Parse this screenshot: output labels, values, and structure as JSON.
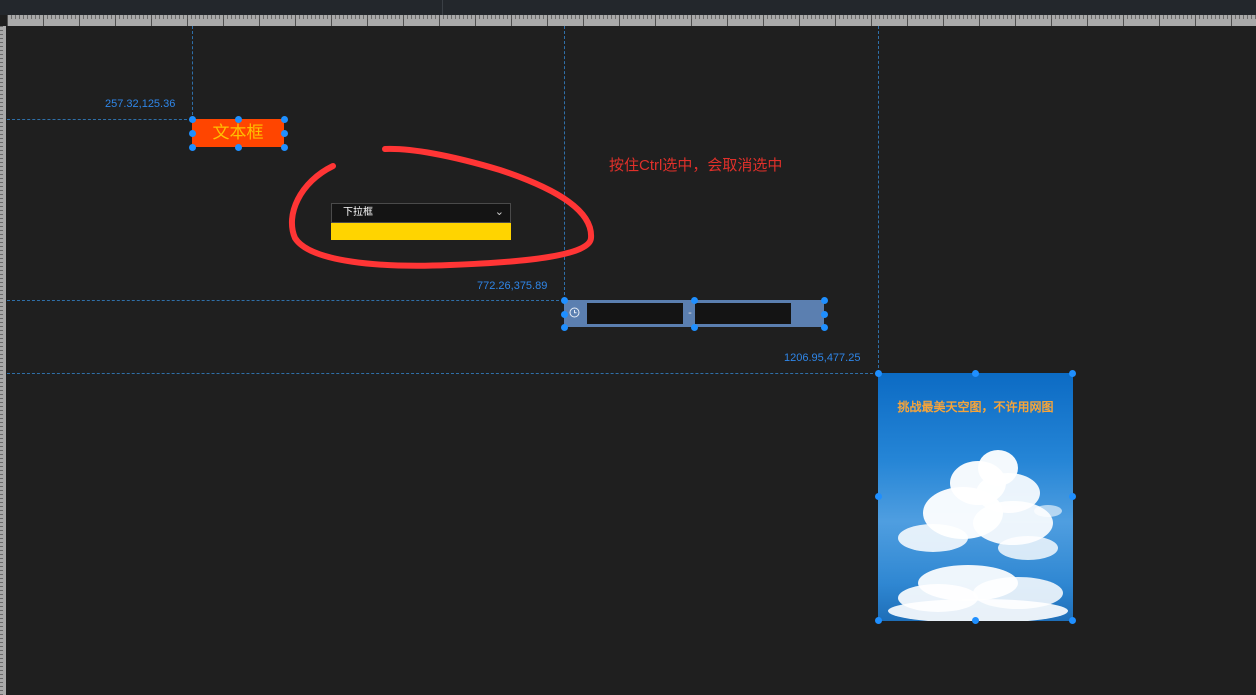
{
  "coords": {
    "textbox": "257.32,125.36",
    "datepicker": "772.26,375.89",
    "image": "1206.95,477.25"
  },
  "textbox": {
    "label": "文本框"
  },
  "dropdown": {
    "label": "下拉框",
    "chevron": "chevron-down"
  },
  "annotation": {
    "text": "按住Ctrl选中，会取消选中"
  },
  "daterange": {
    "separator": "-",
    "start_value": "",
    "end_value": ""
  },
  "image_card": {
    "caption": "挑战最美天空图，不许用网图"
  },
  "colors": {
    "background": "#1f1f1f",
    "selection": "#1f8fff",
    "guide": "#2f6fa8",
    "textbox_bg": "#ff4500",
    "textbox_fg": "#ffc000",
    "dropdown_list": "#ffd400",
    "annotation": "#e0302a",
    "daterange_bg": "#5b7fb0"
  }
}
